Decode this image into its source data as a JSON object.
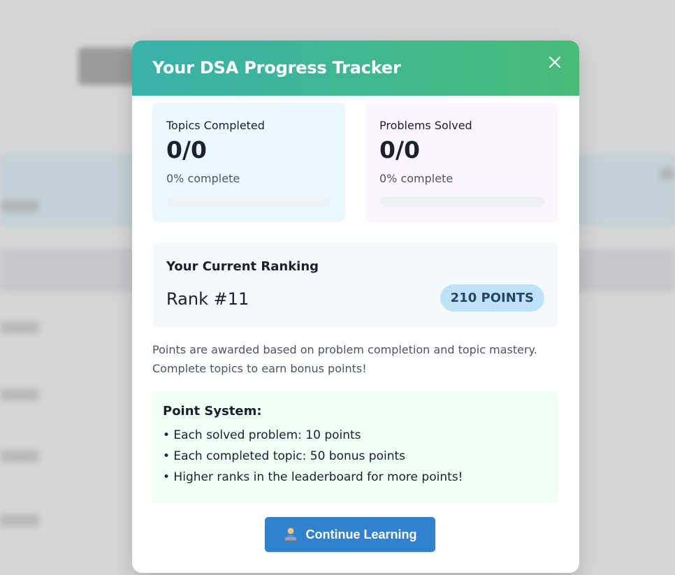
{
  "modal": {
    "title": "Your DSA Progress Tracker",
    "close_icon": "close-icon"
  },
  "stats": {
    "topics": {
      "label": "Topics Completed",
      "value": "0/0",
      "percent_text": "0% complete",
      "progress": 0
    },
    "problems": {
      "label": "Problems Solved",
      "value": "0/0",
      "percent_text": "0% complete",
      "progress": 0
    }
  },
  "ranking": {
    "heading": "Your Current Ranking",
    "rank": "Rank #11",
    "points_badge": "210 POINTS"
  },
  "info_text": "Points are awarded based on problem completion and topic mastery. Complete topics to earn bonus points!",
  "point_system": {
    "heading": "Point System:",
    "rules": [
      "• Each solved problem: 10 points",
      "• Each completed topic: 50 bonus points",
      "• Higher ranks in the leaderboard for more points!"
    ]
  },
  "continue_button": {
    "label": "Continue Learning",
    "icon": "technologist-icon"
  },
  "colors": {
    "header_gradient_start": "#38b2ac",
    "header_gradient_end": "#48bb78",
    "primary_button": "#3182ce",
    "badge_bg": "#bee3f8",
    "topics_card_bg": "#ebf8ff",
    "problems_card_bg": "#faf5ff",
    "point_system_bg": "#f0fff4"
  }
}
